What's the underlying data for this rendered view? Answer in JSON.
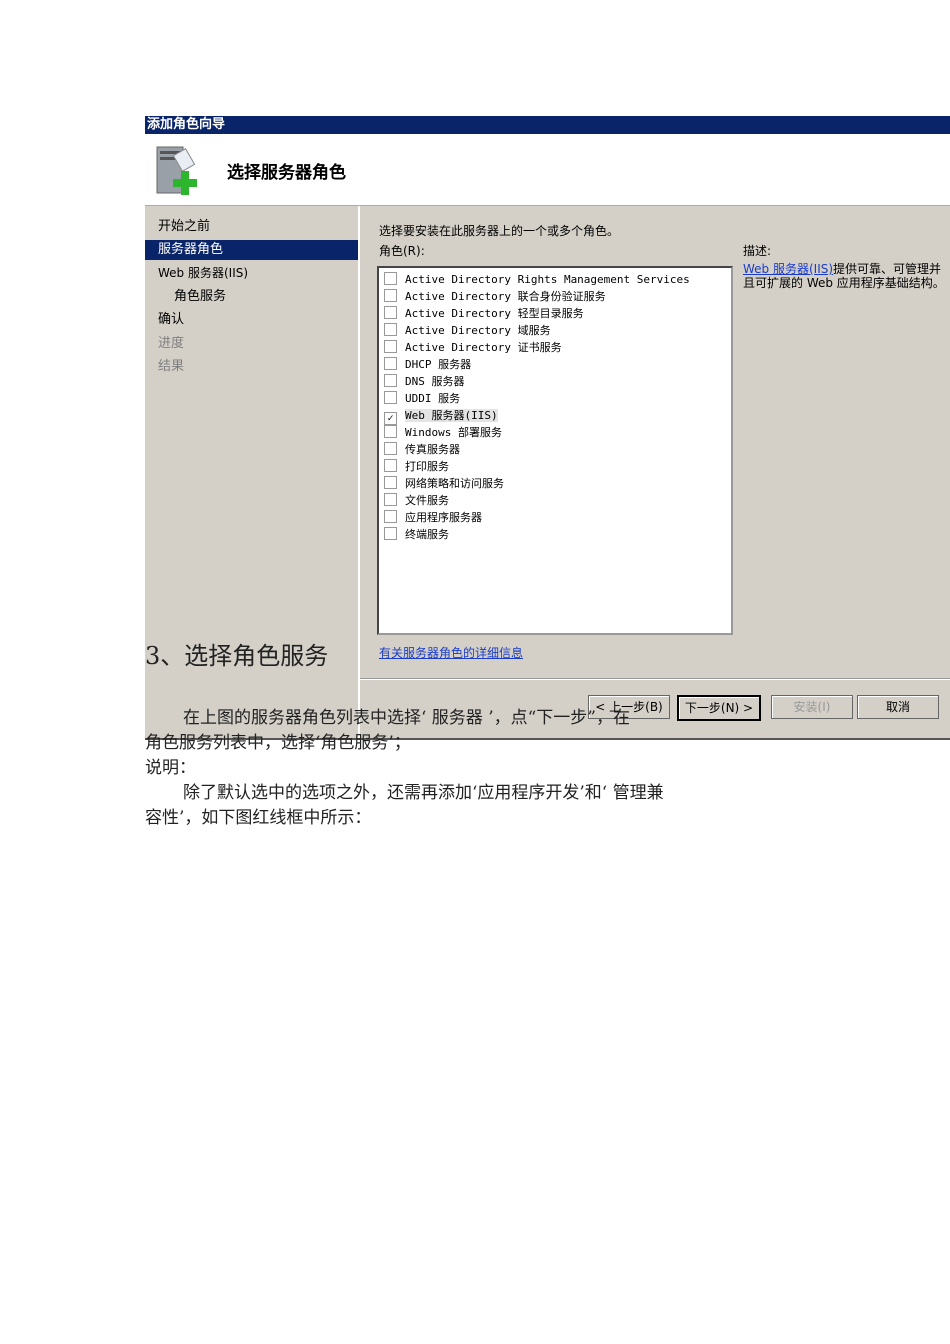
{
  "wizard": {
    "window_title": "添加角色向导",
    "page_title": "选择服务器角色",
    "nav": [
      "开始之前",
      "服务器角色",
      "Web 服务器(IIS)",
      "角色服务",
      "确认",
      "进度",
      "结果"
    ],
    "instruction": "选择要安装在此服务器上的一个或多个角色。",
    "roles_label": "角色(R):",
    "roles": [
      {
        "label": "Active Directory Rights Management Services",
        "checked": false
      },
      {
        "label": "Active Directory 联合身份验证服务",
        "checked": false
      },
      {
        "label": "Active Directory 轻型目录服务",
        "checked": false
      },
      {
        "label": "Active Directory 域服务",
        "checked": false
      },
      {
        "label": "Active Directory 证书服务",
        "checked": false
      },
      {
        "label": "DHCP 服务器",
        "checked": false
      },
      {
        "label": "DNS 服务器",
        "checked": false
      },
      {
        "label": "UDDI 服务",
        "checked": false
      },
      {
        "label": "Web 服务器(IIS)",
        "checked": true
      },
      {
        "label": "Windows 部署服务",
        "checked": false
      },
      {
        "label": "传真服务器",
        "checked": false
      },
      {
        "label": "打印服务",
        "checked": false
      },
      {
        "label": "网络策略和访问服务",
        "checked": false
      },
      {
        "label": "文件服务",
        "checked": false
      },
      {
        "label": "应用程序服务器",
        "checked": false
      },
      {
        "label": "终端服务",
        "checked": false
      }
    ],
    "description_label": "描述:",
    "description_link": "Web 服务器(IIS)",
    "description_text": "提供可靠、可管理并且可扩展的 Web 应用程序基础结构。",
    "more_info_link": "有关服务器角色的详细信息",
    "buttons": {
      "back": "< 上一步(B)",
      "next": "下一步(N) >",
      "install": "安装(I)",
      "cancel": "取消"
    }
  },
  "doc": {
    "heading": "3、选择角色服务",
    "lines": [
      "在上图的服务器角色列表中选择‘ 服务器 ’，点“下一步”，在",
      "角色服务列表中，选择‘角色服务’；",
      "说明：",
      "除了默认选中的选项之外，还需再添加‘应用程序开发’和‘ 管理兼",
      "容性’，如下图红线框中所示："
    ]
  }
}
